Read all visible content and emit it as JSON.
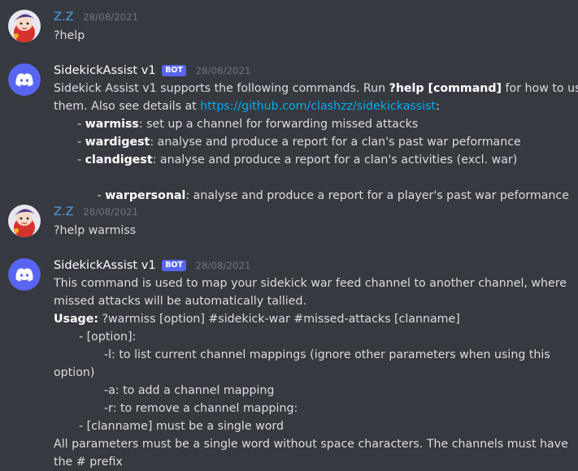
{
  "messages": [
    {
      "user": "Z.Z",
      "timestamp": "28/08/2021",
      "lines": [
        "?help"
      ]
    },
    {
      "user": "SidekickAssist v1",
      "badge": "BOT",
      "timestamp": "28/08/2021",
      "intro_a": "Sidekick Assist v1 supports the following commands. Run ",
      "intro_cmd": "?help [command]",
      "intro_b": " for how to use",
      "intro2_a": "them. Also see details at ",
      "intro2_link": "https://github.com/clashzz/sidekickassist",
      "intro2_b": ":",
      "commands": [
        {
          "prefix": "- ",
          "name": "warmiss",
          "desc": ": set up a channel for forwarding missed attacks"
        },
        {
          "prefix": "- ",
          "name": "wardigest",
          "desc": ": analyse and produce a report for a clan's past war peformance"
        },
        {
          "prefix": "- ",
          "name": "clandigest",
          "desc": ": analyse and produce a report for a clan's activities (excl. war)"
        },
        {
          "prefix": " - ",
          "name": "warpersonal",
          "desc": ": analyse and produce a report for a player's past war peformance"
        }
      ]
    },
    {
      "user": "Z.Z",
      "timestamp": "28/08/2021",
      "lines": [
        "?help warmiss"
      ]
    },
    {
      "user": "SidekickAssist v1",
      "badge": "BOT",
      "timestamp": "28/08/2021",
      "text1": "This command is used to map your sidekick war feed channel to another channel, where",
      "text2": "missed attacks will be automatically tallied.",
      "usage_label": "Usage:",
      "usage_text": " ?warmiss [option] #sidekick-war #missed-attacks [clanname]",
      "opt_header": "- [option]:",
      "opt_l1": "-l: to list current channel mappings (ignore other parameters when using this",
      "opt_l2": "option)",
      "opt_a": "-a: to add a channel mapping",
      "opt_r": "-r: to remove a channel mapping:",
      "clanname": "- [clanname] must be a single word",
      "note1": "All parameters must be a single word without space characters. The channels must have",
      "note2": "the # prefix"
    }
  ],
  "colors": {
    "background": "#36393f",
    "zz_name": "#4a9ee8",
    "bot_badge": "#5865f2",
    "link": "#00aff4",
    "discord_avatar": "#5865f2"
  },
  "icons": {
    "zz_avatar": "anime-character-avatar",
    "bot_avatar": "discord-logo-icon"
  }
}
